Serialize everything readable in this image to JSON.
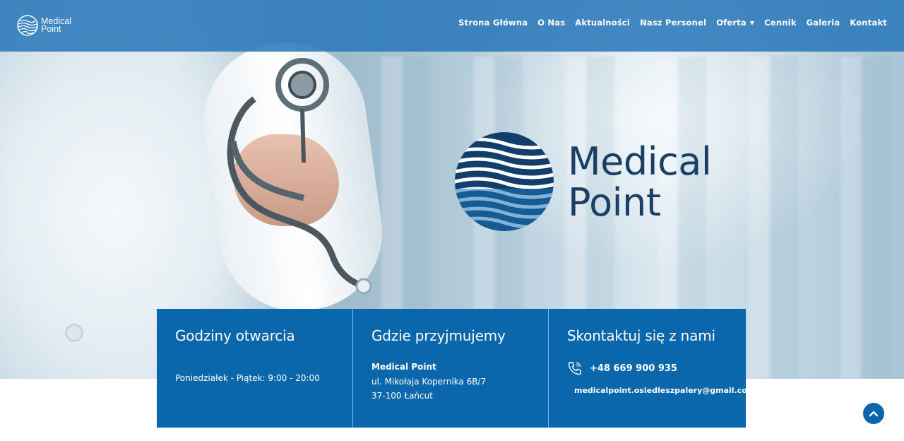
{
  "brand": {
    "line1": "Medical",
    "line2": "Point"
  },
  "nav": [
    {
      "label": "Strona Główna"
    },
    {
      "label": "O Nas"
    },
    {
      "label": "Aktualności"
    },
    {
      "label": "Nasz Personel"
    },
    {
      "label": "Oferta",
      "has_dropdown": true
    },
    {
      "label": "Cennik"
    },
    {
      "label": "Galeria"
    },
    {
      "label": "Kontakt"
    }
  ],
  "hero": {
    "logo_line1": "Medical",
    "logo_line2": "Point"
  },
  "panels": {
    "hours": {
      "title": "Godziny otwarcia",
      "text": "Poniedziałek - Piątek: 9:00 - 20:00"
    },
    "location": {
      "title": "Gdzie przyjmujemy",
      "name": "Medical Point",
      "street": "ul. Mikołaja Kopernika 6B/7",
      "city": "37-100 Łańcut"
    },
    "contact": {
      "title": "Skontaktuj się z nami",
      "phone": "+48 669 900 935",
      "email": "medicalpoint.osiedleszpalery@gmail.com"
    }
  },
  "colors": {
    "topbar": "#2b79b9",
    "panel": "#0a67ab",
    "logo_text": "#1a3f66"
  },
  "icons": [
    "phone-icon",
    "mail-icon",
    "chevron-up-icon",
    "caret-down-icon"
  ]
}
